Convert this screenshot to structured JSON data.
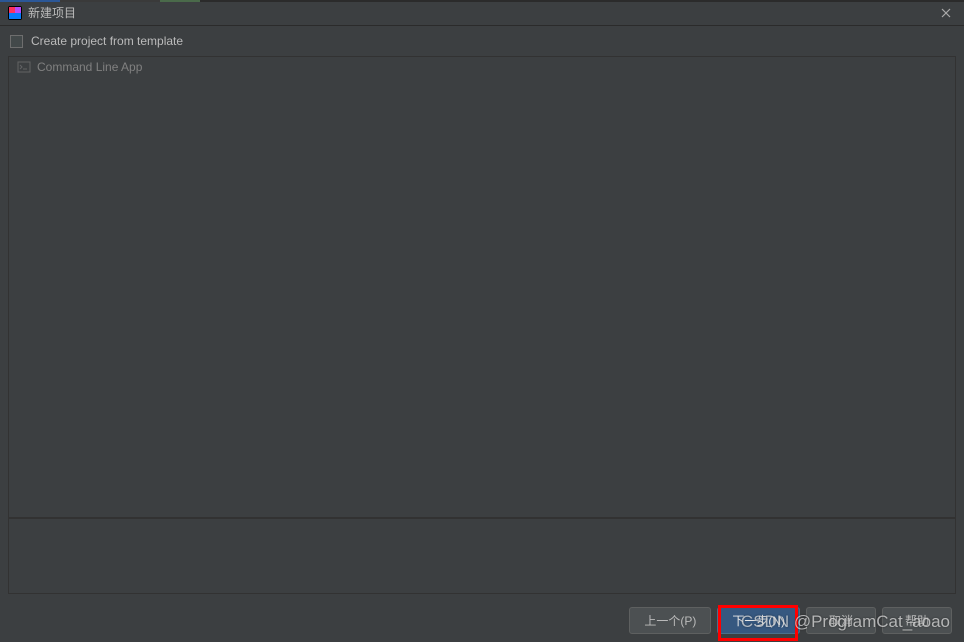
{
  "titlebar": {
    "title": "新建项目"
  },
  "options": {
    "create_from_template_label": "Create project from template"
  },
  "templates": {
    "items": [
      {
        "label": "Command Line App"
      }
    ]
  },
  "footer": {
    "previous_label": "上一个(P)",
    "next_label": "下一步(N)",
    "cancel_label": "取消",
    "help_label": "帮助"
  },
  "watermark": "CSDN @ProgramCat_aoao"
}
